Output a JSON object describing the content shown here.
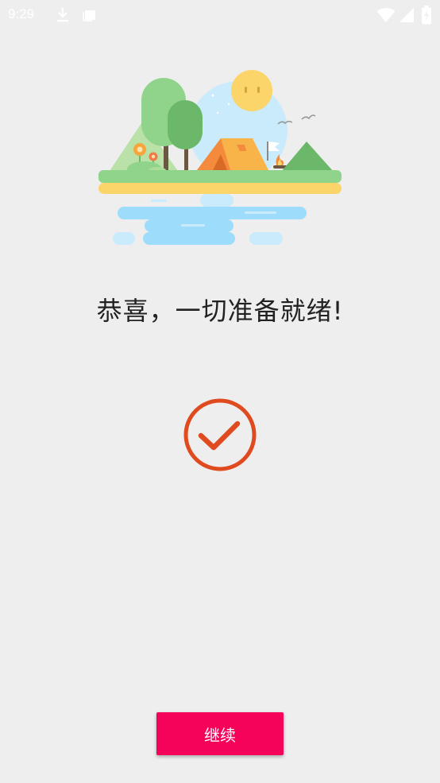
{
  "status_bar": {
    "time": "9:29",
    "icons": [
      "download-icon",
      "image-icon",
      "wifi-icon",
      "signal-icon",
      "battery-icon"
    ]
  },
  "main": {
    "headline": "恭喜，一切准备就绪!",
    "illustration_icon": "camping-scene-illustration",
    "status_icon": "check-circle-icon",
    "status_color": "#e04a1f"
  },
  "footer": {
    "continue_label": "继续",
    "accent_color": "#f5025a"
  }
}
